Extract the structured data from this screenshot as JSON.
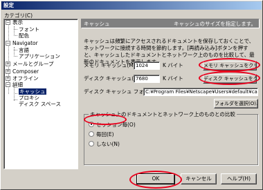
{
  "window": {
    "title": "設定"
  },
  "sidebar": {
    "label": "カテゴリ(C)",
    "items": [
      {
        "label": "表示",
        "expander": "−"
      },
      {
        "label": "フォント"
      },
      {
        "label": "配色"
      },
      {
        "label": "Navigator",
        "expander": "−"
      },
      {
        "label": "言語"
      },
      {
        "label": "アプリケーション"
      },
      {
        "label": "メールとグループ",
        "expander": "+"
      },
      {
        "label": "Composer",
        "expander": "+"
      },
      {
        "label": "オフライン",
        "expander": "+"
      },
      {
        "label": "詳細",
        "expander": "−"
      },
      {
        "label": "キャッシュ"
      },
      {
        "label": "プロキシ"
      },
      {
        "label": "ディスク スペース"
      }
    ]
  },
  "panel": {
    "title": "キャッシュ",
    "subtitle": "キャッシュのサイズを指定します。",
    "description": "キャッシュは頻繁にアクセスされるドキュメントを保存しておくことで、ネットワークに接続する時間を節約します。[再読み込み]ボタンを押すと、キャッシュしたドキュメントとネットワーク上のものを比較して、最新のドキュメントを表示します。",
    "memory_cache_label": "メモリ キャッシュ(M):",
    "memory_cache_value": "1024",
    "memory_cache_unit": "K バイト",
    "clear_memory_button": "メモリ キャッシュをクリア(L)",
    "disk_cache_label": "ディスク キャッシュ(D):",
    "disk_cache_value": "7680",
    "disk_cache_unit": "K バイト",
    "clear_disk_button": "ディスク キャッシュをクリア(K)",
    "disk_folder_label": "ディスク キャッシュ フォルダ(F):",
    "disk_folder_value": "C:¥Program Files¥Netscape¥Users¥default¥ca",
    "choose_folder_button": "フォルダを選択(O)...",
    "compare_group_label": "キャッシュ上のドキュメントとネットワーク上のものとの比較",
    "radio_options": [
      {
        "label": "セッション毎(O)",
        "selected": true
      },
      {
        "label": "毎回(E)",
        "selected": false
      },
      {
        "label": "しない(N)",
        "selected": false
      }
    ]
  },
  "footer": {
    "ok_label": "OK",
    "cancel_label": "キャンセル",
    "help_label": "ヘルプ(H)"
  },
  "colors": {
    "annotation": "#e8001c",
    "selection": "#0a246a",
    "header": "#808080"
  }
}
